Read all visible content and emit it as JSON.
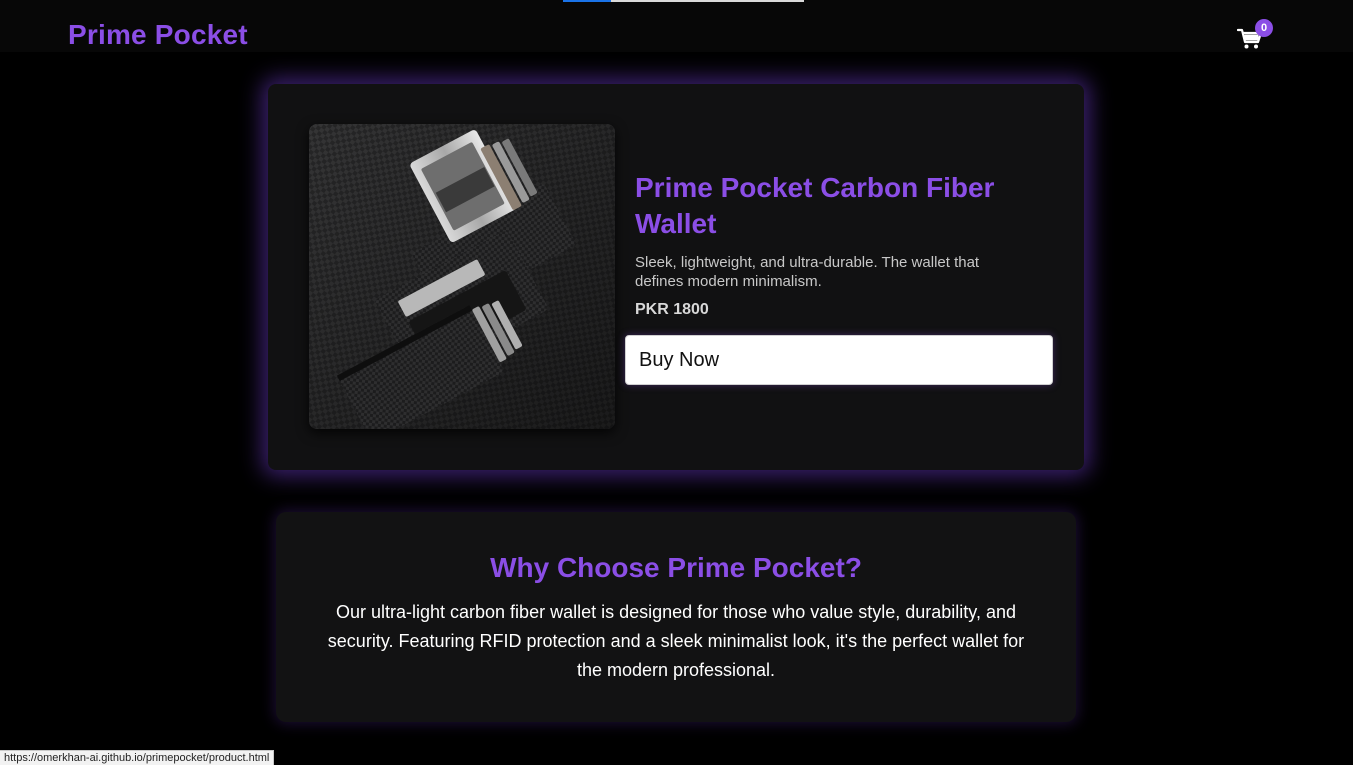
{
  "header": {
    "brand": "Prime Pocket",
    "loading_progress": 0.2,
    "cart": {
      "icon": "shopping-cart-icon",
      "count": "0"
    }
  },
  "product": {
    "image_alt": "Carbon fiber wallet with cards",
    "title": "Prime Pocket Carbon Fiber Wallet",
    "description": "Sleek, lightweight, and ultra-durable. The wallet that defines modern minimalism.",
    "price": "PKR 1800",
    "buy_label": "Buy Now"
  },
  "why": {
    "title": "Why Choose Prime Pocket?",
    "text": "Our ultra-light carbon fiber wallet is designed for those who value style, durability, and security. Featuring RFID protection and a sleek minimalist look, it's the perfect wallet for the modern professional."
  },
  "status_bar": {
    "url": "https://omerkhan-ai.github.io/primepocket/product.html"
  },
  "colors": {
    "accent": "#8b4ee6",
    "background": "#000000",
    "card": "#111112"
  }
}
